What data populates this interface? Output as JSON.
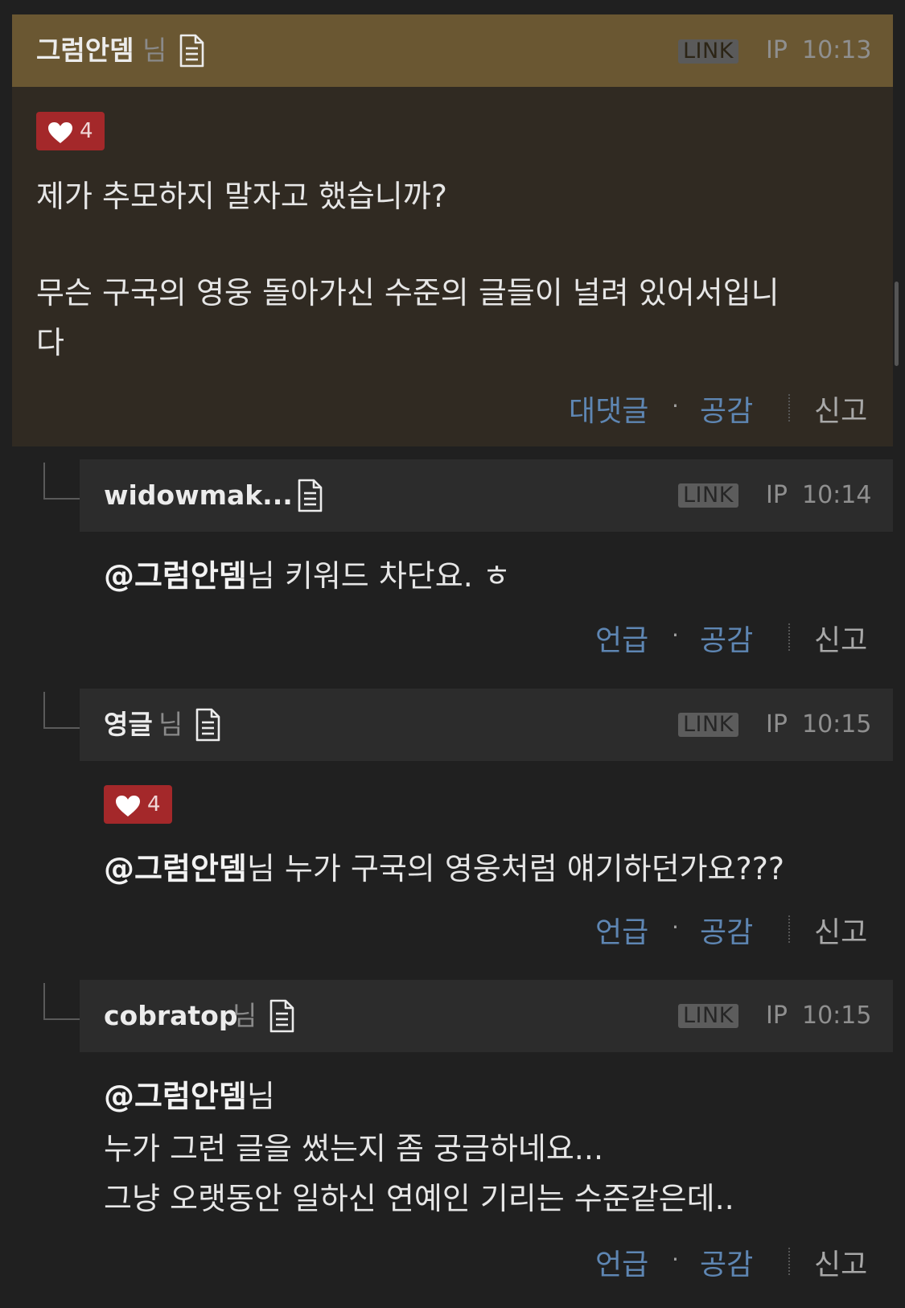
{
  "comments": [
    {
      "author": "그럼안뎀",
      "suffix": "님",
      "badge": "LINK",
      "ip": "IP",
      "time": "10:13",
      "likes": "4",
      "lines": [
        "제가 추모하지 말자고 했습니까?",
        "",
        "무슨 구국의 영웅 돌아가신 수준의 글들이 널려 있어서입니",
        "다"
      ],
      "actions": {
        "reply": "대댓글",
        "like": "공감",
        "report": "신고"
      }
    },
    {
      "author": "widowmak...",
      "badge": "LINK",
      "ip": "IP",
      "time": "10:14",
      "mention": "@그럼안뎀",
      "mention_suffix": "님 키워드 차단요. ㅎ",
      "actions": {
        "reply": "언급",
        "like": "공감",
        "report": "신고"
      }
    },
    {
      "author": "영글",
      "suffix": "님",
      "badge": "LINK",
      "ip": "IP",
      "time": "10:15",
      "likes": "4",
      "mention": "@그럼안뎀",
      "mention_suffix": "님 누가 구국의 영웅처럼 얘기하던가요???",
      "actions": {
        "reply": "언급",
        "like": "공감",
        "report": "신고"
      }
    },
    {
      "author": "cobratop",
      "suffix": "님",
      "badge": "LINK",
      "ip": "IP",
      "time": "10:15",
      "mention": "@그럼안뎀",
      "mention_suffix": "님",
      "lines": [
        "누가 그런 글을 썼는지 좀 궁금하네요...",
        "그냥 오랫동안 일하신 연예인 기리는 수준같은데.."
      ],
      "actions": {
        "reply": "언급",
        "like": "공감",
        "report": "신고"
      }
    }
  ],
  "separator_dot": "·",
  "icons": {
    "document": "document-icon",
    "heart": "heart-icon"
  }
}
